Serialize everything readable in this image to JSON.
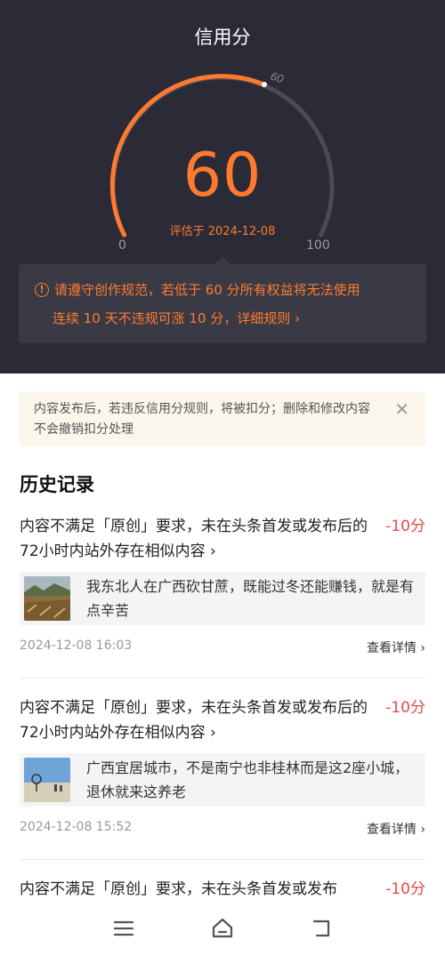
{
  "header": {
    "title": "信用分",
    "gauge_top_label": "60"
  },
  "score": {
    "value": "60",
    "evaluated": "评估于 2024-12-08",
    "min_label": "0",
    "max_label": "100",
    "fraction": 0.6
  },
  "notice": {
    "line1": "请遵守创作规范，若低于 60 分所有权益将无法使用",
    "line2": "连续 10 天不违规可涨 10 分，详细规则 ›"
  },
  "tip": {
    "text": "内容发布后，若违反信用分规则，将被扣分；删除和修改内容不会撤销扣分处理",
    "close": "✕"
  },
  "history": {
    "title": "历史记录",
    "records": [
      {
        "reason": "内容不满足「原创」要求，未在头条首发或发布后的72小时内站外存在相似内容 ›",
        "points": "-10分",
        "article": "我东北人在广西砍甘蔗，既能过冬还能赚钱，就是有点辛苦",
        "time": "2024-12-08 16:03",
        "detail": "查看详情 ›"
      },
      {
        "reason": "内容不满足「原创」要求，未在头条首发或发布后的72小时内站外存在相似内容 ›",
        "points": "-10分",
        "article": "广西宜居城市，不是南宁也非桂林而是这2座小城，退休就来这养老",
        "time": "2024-12-08 15:52",
        "detail": "查看详情 ›"
      },
      {
        "reason": "内容不满足「原创」要求，未在头条首发或发布",
        "points": "-10分"
      }
    ]
  },
  "nav": {
    "icons": [
      "menu-icon",
      "home-icon",
      "back-icon"
    ]
  },
  "colors": {
    "accent": "#ff7a2e",
    "dark_bg": "#2b2b38",
    "penalty": "#e5484d"
  }
}
